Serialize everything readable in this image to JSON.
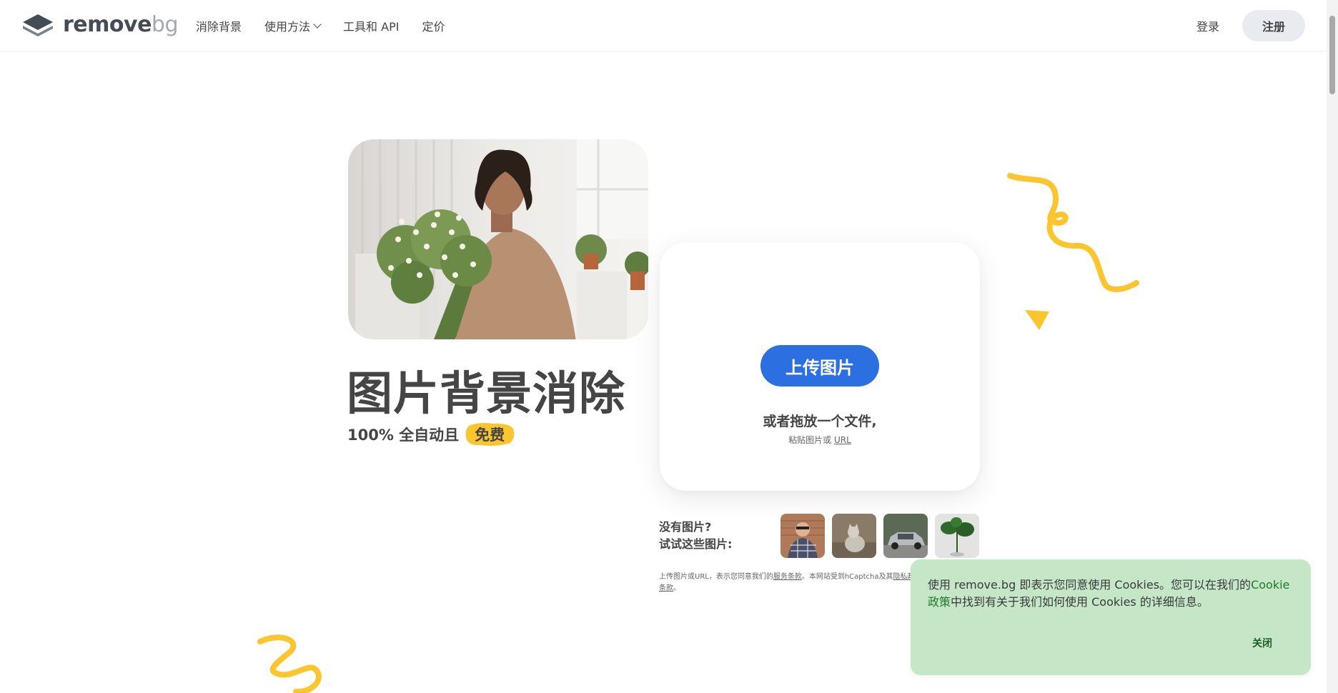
{
  "header": {
    "logo": {
      "name_main": "remove",
      "name_suffix": "bg"
    },
    "nav": [
      {
        "label": "消除背景"
      },
      {
        "label": "使用方法",
        "has_dropdown": true
      },
      {
        "label": "工具和 API"
      },
      {
        "label": "定价"
      }
    ],
    "login_label": "登录",
    "signup_label": "注册"
  },
  "hero": {
    "title": "图片背景消除",
    "subtitle": "100% 全自动且",
    "free_badge": "免费"
  },
  "upload": {
    "button_label": "上传图片",
    "drop_text": "或者拖放一个文件,",
    "paste_prefix": "粘贴图片或",
    "paste_url": "URL"
  },
  "samples": {
    "line1": "没有图片?",
    "line2": "试试这些图片:",
    "items": [
      {
        "icon": "person-thumbnail"
      },
      {
        "icon": "cat-thumbnail"
      },
      {
        "icon": "car-thumbnail"
      },
      {
        "icon": "plant-thumbnail"
      }
    ]
  },
  "terms": {
    "prefix": "上传图片或URL，表示您同意我们的",
    "terms_link": "服务条款",
    "middle": "。本网站受到hCaptcha及其",
    "privacy_link": "隐私政",
    "suffix_link": "条款",
    "end": "。"
  },
  "cookie": {
    "text_before": "使用 remove.bg 即表示您同意使用 Cookies。您可以在我们的",
    "link": "Cookie政策",
    "text_after": "中找到有关于我们如何使用 Cookies 的详细信息。",
    "close_label": "关闭"
  },
  "colors": {
    "accent_blue": "#2c6fe0",
    "deco_yellow": "#fbc52f",
    "cookie_bg": "#c5e7c8"
  }
}
